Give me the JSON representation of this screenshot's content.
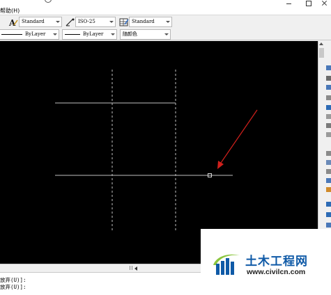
{
  "menubar": {
    "help_label": "帮助(H)"
  },
  "toolbar1": {
    "text_style": "Standard",
    "dim_style": "ISO-25",
    "table_style": "Standard"
  },
  "toolbar2": {
    "linetype": "ByLayer",
    "lineweight": "ByLayer",
    "color": "随颜色"
  },
  "command": {
    "lines": [
      "放弃(U)]:",
      "放弃(U)]:"
    ]
  },
  "watermark": {
    "title": "土木工程网",
    "url": "www.civilcn.com"
  },
  "colors": {
    "canvas_bg": "#000000",
    "drawn_lines": "#bfbfbf",
    "arrow": "#d0201c",
    "watermark_blue": "#0f5aa7"
  },
  "icons": [
    "text-style-icon",
    "dim-style-icon",
    "table-style-icon",
    "scroll-left-icon",
    "scroll-up-icon",
    "restore-icon",
    "close-icon",
    "minimize-icon"
  ]
}
